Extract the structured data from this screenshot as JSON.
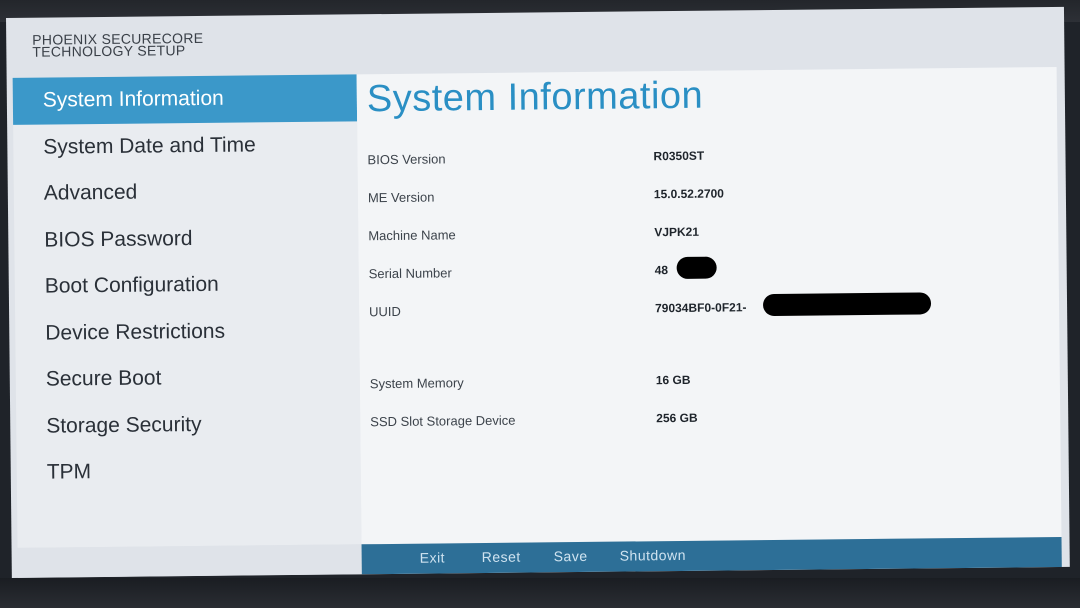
{
  "brand": {
    "line1": "PHOENIX SECURECORE",
    "line2": "TECHNOLOGY SETUP"
  },
  "sidebar": {
    "items": [
      {
        "label": "System Information",
        "active": true
      },
      {
        "label": "System Date and Time"
      },
      {
        "label": "Advanced"
      },
      {
        "label": "BIOS Password"
      },
      {
        "label": "Boot Configuration"
      },
      {
        "label": "Device Restrictions"
      },
      {
        "label": "Secure Boot"
      },
      {
        "label": "Storage Security"
      },
      {
        "label": "TPM"
      }
    ]
  },
  "main": {
    "title": "System Information",
    "rows": [
      {
        "label": "BIOS Version",
        "value": "R0350ST"
      },
      {
        "label": "ME Version",
        "value": "15.0.52.2700"
      },
      {
        "label": "Machine Name",
        "value": "VJPK21"
      },
      {
        "label": "Serial Number",
        "value": "48"
      },
      {
        "label": "UUID",
        "value": "79034BF0-0F21-"
      },
      {
        "label": "System Memory",
        "value": "16 GB"
      },
      {
        "label": "SSD Slot Storage Device",
        "value": "256 GB"
      }
    ]
  },
  "footer": {
    "exit": "Exit",
    "reset": "Reset",
    "save": "Save",
    "shutdown": "Shutdown"
  },
  "colors": {
    "accent": "#3b98c9",
    "title": "#2a8fc4",
    "footer_bar": "#2d6f97"
  }
}
